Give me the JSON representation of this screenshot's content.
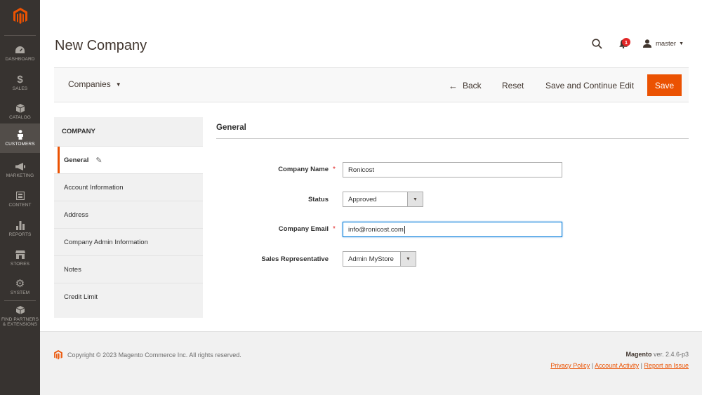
{
  "header": {
    "title": "New Company",
    "notifications_count": "1",
    "user_name": "master"
  },
  "sidebar": {
    "items": [
      {
        "label": "DASHBOARD",
        "icon": "dashboard-icon"
      },
      {
        "label": "SALES",
        "icon": "dollar-icon"
      },
      {
        "label": "CATALOG",
        "icon": "cube-icon"
      },
      {
        "label": "CUSTOMERS",
        "icon": "customer-icon",
        "active": true
      },
      {
        "label": "MARKETING",
        "icon": "megaphone-icon"
      },
      {
        "label": "CONTENT",
        "icon": "content-icon"
      },
      {
        "label": "REPORTS",
        "icon": "bar-chart-icon"
      },
      {
        "label": "STORES",
        "icon": "store-icon"
      },
      {
        "label": "SYSTEM",
        "icon": "gear-icon"
      },
      {
        "label_line1": "FIND PARTNERS",
        "label_line2": "& EXTENSIONS",
        "icon": "box-icon"
      }
    ]
  },
  "toolbar": {
    "switcher_label": "Companies",
    "back_label": "Back",
    "reset_label": "Reset",
    "save_continue_label": "Save and Continue Edit",
    "save_label": "Save"
  },
  "tabs": {
    "title": "COMPANY",
    "items": [
      {
        "label": "General",
        "active": true
      },
      {
        "label": "Account Information"
      },
      {
        "label": "Address"
      },
      {
        "label": "Company Admin Information"
      },
      {
        "label": "Notes"
      },
      {
        "label": "Credit Limit"
      }
    ]
  },
  "form": {
    "section_title": "General",
    "company_name_label": "Company Name",
    "company_name_value": "Ronicost",
    "status_label": "Status",
    "status_value": "Approved",
    "company_email_label": "Company Email",
    "company_email_value": "info@ronicost.com",
    "sales_rep_label": "Sales Representative",
    "sales_rep_value": "Admin MyStore"
  },
  "footer": {
    "copyright": "Copyright © 2023 Magento Commerce Inc. All rights reserved.",
    "brand": "Magento",
    "version": " ver. 2.4.6-p3",
    "links": [
      "Privacy Policy",
      "Account Activity",
      "Report an Issue"
    ]
  },
  "colors": {
    "accent": "#eb5202",
    "sidebar_bg": "#373330",
    "badge": "#e22626"
  }
}
